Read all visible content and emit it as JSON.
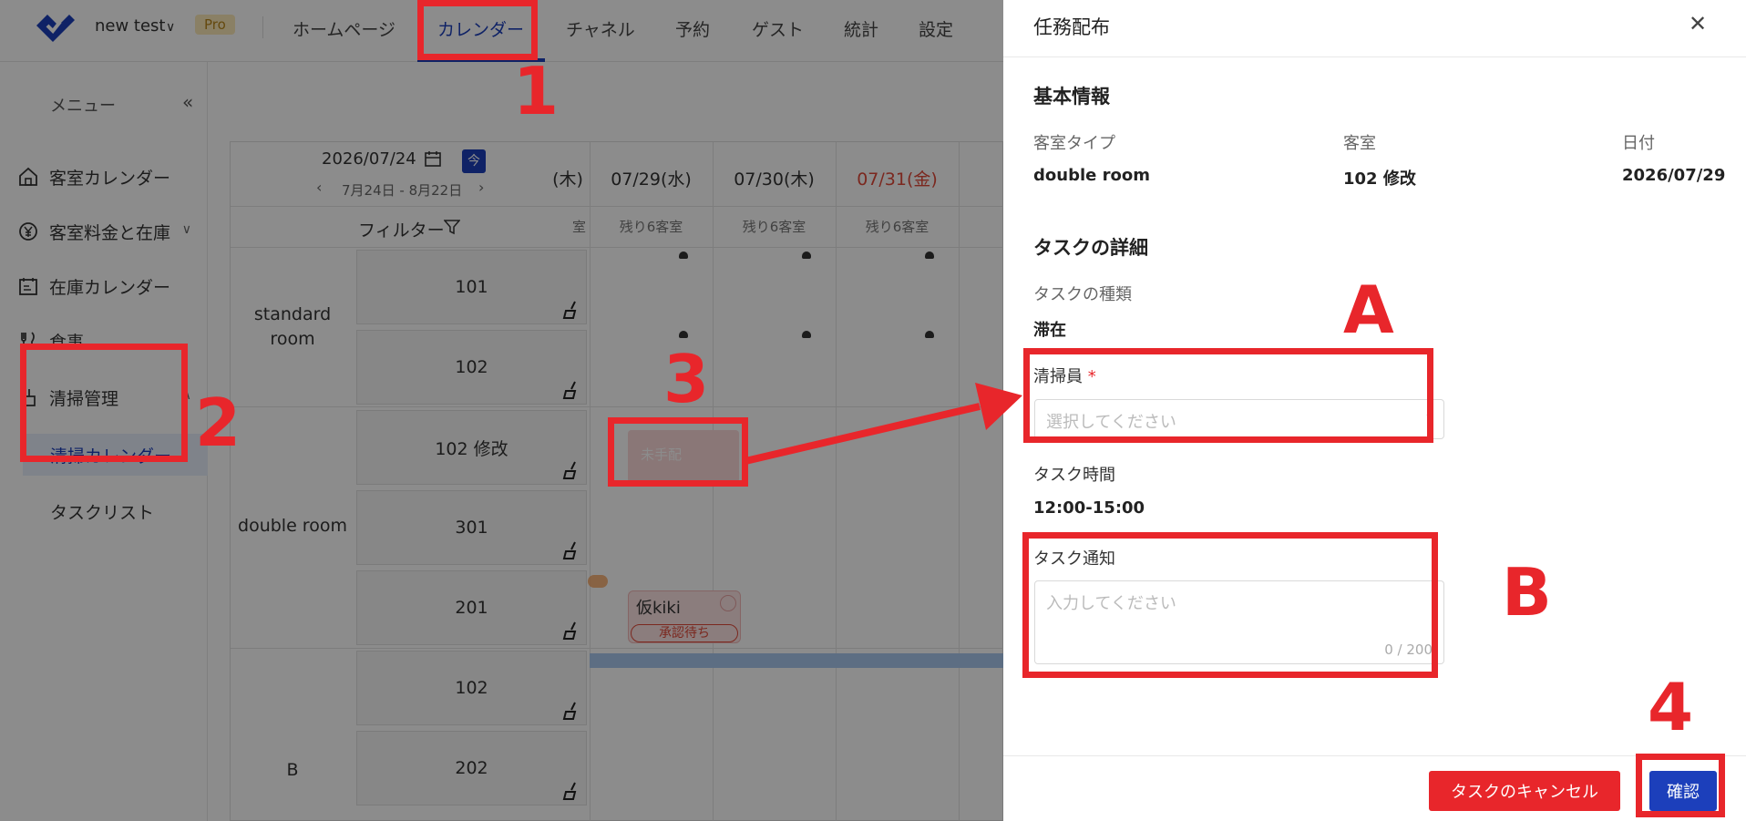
{
  "org": {
    "name": "new test",
    "plan": "Pro"
  },
  "topnav": {
    "items": [
      {
        "label": "ホームページ"
      },
      {
        "label": "カレンダー"
      },
      {
        "label": "チャネル"
      },
      {
        "label": "予約"
      },
      {
        "label": "ゲスト"
      },
      {
        "label": "統計"
      },
      {
        "label": "設定"
      }
    ]
  },
  "sidebar": {
    "header": "メニュー",
    "items": [
      {
        "label": "客室カレンダー",
        "icon": "home-icon"
      },
      {
        "label": "客室料金と在庫",
        "icon": "yen-icon"
      },
      {
        "label": "在庫カレンダー",
        "icon": "calendar-icon"
      },
      {
        "label": "食事",
        "icon": "utensils-icon"
      },
      {
        "label": "清掃管理",
        "icon": "broom-icon"
      }
    ],
    "subitems": [
      {
        "label": "清掃カレンダー",
        "active": true
      },
      {
        "label": "タスクリスト",
        "active": false
      }
    ]
  },
  "calendar": {
    "date": "2026/07/24",
    "today_label": "今",
    "range": "7月24日 - 8月22日",
    "filter_label": "フィルター",
    "partial_day": "(木)",
    "partial_remain": "室",
    "days": [
      {
        "label": "07/29(水)",
        "remain": "残り6客室",
        "weekend": false
      },
      {
        "label": "07/30(木)",
        "remain": "残り6客室",
        "weekend": false
      },
      {
        "label": "07/31(金)",
        "remain": "残り6客室",
        "weekend": true
      }
    ],
    "room_types": [
      {
        "name": "standard room",
        "rooms": [
          "101",
          "102"
        ]
      },
      {
        "name": "double room",
        "rooms": [
          "102 修改",
          "301",
          "201"
        ]
      },
      {
        "name": "B",
        "rooms": [
          "102",
          "202"
        ]
      }
    ],
    "bookings": {
      "unassigned": "未手配",
      "guest_name": "仮kiki",
      "guest_status": "承認待ち"
    }
  },
  "drawer": {
    "title": "任務配布",
    "basic_section": "基本情報",
    "room_type_label": "客室タイプ",
    "room_type_value": "double room",
    "room_label": "客室",
    "room_value": "102 修改",
    "date_label": "日付",
    "date_value": "2026/07/29",
    "detail_section": "タスクの詳細",
    "task_type_label": "タスクの種類",
    "task_type_value": "滞在",
    "cleaner_label": "清掃員",
    "cleaner_required": "*",
    "cleaner_placeholder": "選択してください",
    "task_time_label": "タスク時間",
    "task_time_value": "12:00-15:00",
    "notify_label": "タスク通知",
    "notify_placeholder": "入力してください",
    "notify_count": "0 / 200",
    "cancel_button": "タスクのキャンセル",
    "confirm_button": "確認"
  },
  "annotations": {
    "n1": "1",
    "n2": "2",
    "n3": "3",
    "n4": "4",
    "a": "A",
    "b": "B",
    "color": "#e8262b"
  }
}
